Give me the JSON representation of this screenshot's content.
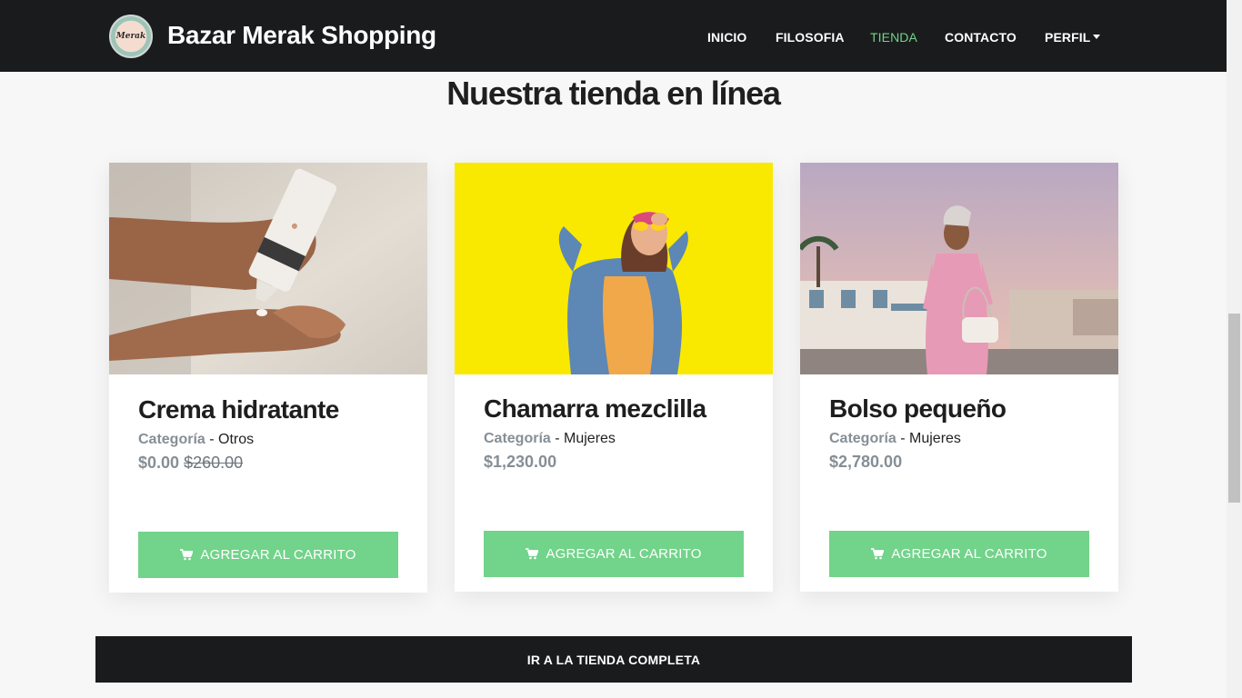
{
  "navbar": {
    "brand_name": "Bazar Merak Shopping",
    "logo_text": "Merak",
    "links": [
      {
        "label": "INICIO",
        "active": false
      },
      {
        "label": "FILOSOFIA",
        "active": false
      },
      {
        "label": "TIENDA",
        "active": true
      },
      {
        "label": "CONTACTO",
        "active": false
      },
      {
        "label": "PERFIL",
        "active": false
      }
    ]
  },
  "section": {
    "title": "Nuestra tienda en línea"
  },
  "products": [
    {
      "title": "Crema hidratante",
      "category_label": "Categoría",
      "category_sep": " - ",
      "category": "Otros",
      "price": "$0.00",
      "old_price": "$260.00",
      "button_label": "AGREGAR AL CARRITO",
      "image": "hands-with-lotion-tube"
    },
    {
      "title": "Chamarra mezclilla",
      "category_label": "Categoría",
      "category_sep": " - ",
      "category": "Mujeres",
      "price": "$1,230.00",
      "old_price": "",
      "button_label": "AGREGAR AL CARRITO",
      "image": "woman-denim-jacket-yellow-wall"
    },
    {
      "title": "Bolso pequeño",
      "category_label": "Categoría",
      "category_sep": " - ",
      "category": "Mujeres",
      "price": "$2,780.00",
      "old_price": "",
      "button_label": "AGREGAR AL CARRITO",
      "image": "woman-pink-dress-small-bag"
    }
  ],
  "footer_button": {
    "label": "IR A LA TIENDA COMPLETA"
  },
  "colors": {
    "navbar_bg": "#1a1b1c",
    "accent_green": "#72d38a",
    "page_bg": "#f7f7f7"
  },
  "icons": {
    "cart": "cart-icon",
    "dropdown": "caret-down-icon"
  }
}
